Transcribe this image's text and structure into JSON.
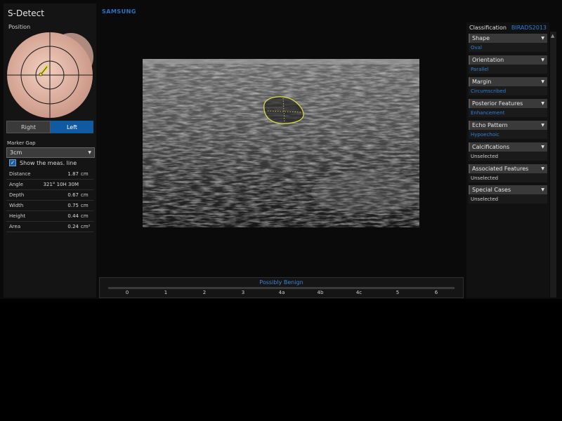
{
  "app": {
    "title": "S-Detect",
    "brand": "SAMSUNG"
  },
  "left_panel": {
    "position_label": "Position",
    "side": {
      "right_label": "Right",
      "left_label": "Left",
      "selected": "Left"
    },
    "marker_gap": {
      "label": "Marker Gap",
      "value": "3cm"
    },
    "show_meas_line": {
      "label": "Show the meas. line",
      "checked": true
    },
    "measurements": [
      {
        "label": "Distance",
        "value": "1.87",
        "unit": "cm"
      },
      {
        "label": "Angle",
        "value": "321° 10H 30M",
        "unit": ""
      },
      {
        "label": "Depth",
        "value": "0.67",
        "unit": "cm"
      },
      {
        "label": "Width",
        "value": "0.75",
        "unit": "cm"
      },
      {
        "label": "Height",
        "value": "0.44",
        "unit": "cm"
      },
      {
        "label": "Area",
        "value": "0.24",
        "unit": "cm²"
      }
    ]
  },
  "bottom_bar": {
    "result": "Possibly Benign",
    "scale": [
      "0",
      "1",
      "2",
      "3",
      "4a",
      "4b",
      "4c",
      "5",
      "6"
    ]
  },
  "classification": {
    "title": "Classification",
    "version": "BIRADS2013",
    "features": [
      {
        "name": "Shape",
        "value": "Oval",
        "selected": true
      },
      {
        "name": "Orientation",
        "value": "Parallel",
        "selected": true
      },
      {
        "name": "Margin",
        "value": "Circumscribed",
        "selected": true
      },
      {
        "name": "Posterior Features",
        "value": "Enhancement",
        "selected": true
      },
      {
        "name": "Echo Pattern",
        "value": "Hypoechoic",
        "selected": true
      },
      {
        "name": "Calcifications",
        "value": "Unselected",
        "selected": false
      },
      {
        "name": "Associated Features",
        "value": "Unselected",
        "selected": false
      },
      {
        "name": "Special Cases",
        "value": "Unselected",
        "selected": false
      }
    ]
  },
  "colors": {
    "accent_blue": "#2f7fd4",
    "selected_button": "#0f5aa0",
    "lesion_outline": "#d8d84a",
    "breast_diagram": "#e8b8a8"
  },
  "icons": [
    "chevron-down-icon",
    "checkbox-checked-icon",
    "scroll-up-icon",
    "probe-marker-icon"
  ]
}
